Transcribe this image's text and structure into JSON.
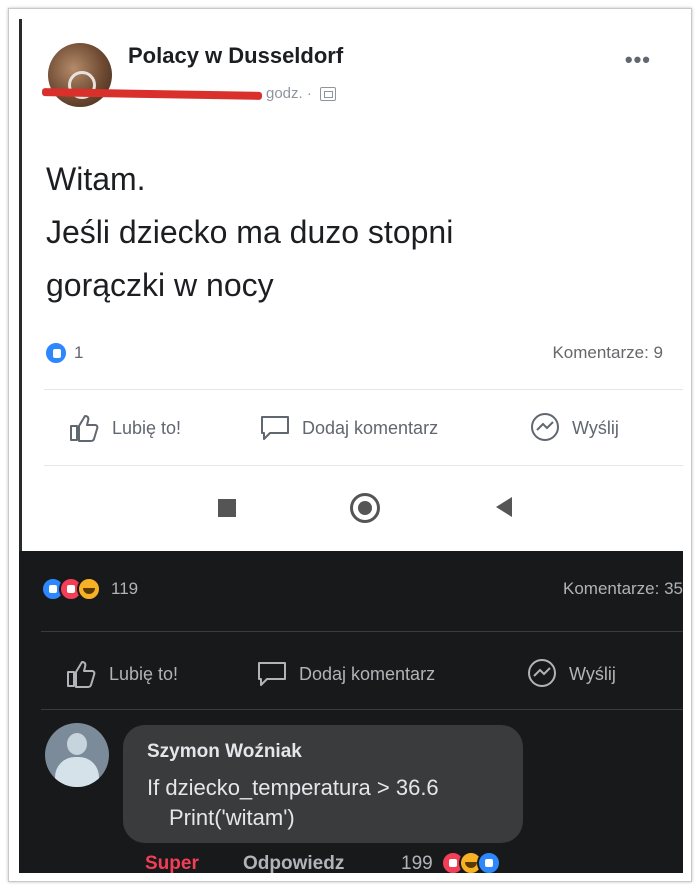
{
  "post_top": {
    "group_name": "Polacy w Dusseldorf",
    "meta_time": "godz. ·",
    "text_line1": "Witam.",
    "text_line2": "Jeśli dziecko ma duzo stopni",
    "text_line3": "gorączki w nocy",
    "like_count": "1",
    "comments": "Komentarze: 9",
    "actions": {
      "like": "Lubię to!",
      "comment": "Dodaj komentarz",
      "send": "Wyślij"
    }
  },
  "post_bottom": {
    "reaction_count": "119",
    "comments": "Komentarze: 35",
    "actions": {
      "like": "Lubię to!",
      "comment": "Dodaj komentarz",
      "send": "Wyślij"
    },
    "comment": {
      "author": "Szymon Woźniak",
      "line1": "If dziecko_temperatura > 36.6",
      "line2": "Print('witam')",
      "reaction_given": "Super",
      "reply_label": "Odpowiedz",
      "reaction_count": "199"
    }
  },
  "colors": {
    "like_blue": "#2d88ff",
    "love_red": "#f33e58",
    "haha_yellow": "#f7b125",
    "redaction": "#d9302b",
    "dark_bg": "#18191a"
  },
  "icons": [
    "thumbs-up-icon",
    "comment-bubble-icon",
    "messenger-icon",
    "globe-icon",
    "more-dots-icon"
  ]
}
